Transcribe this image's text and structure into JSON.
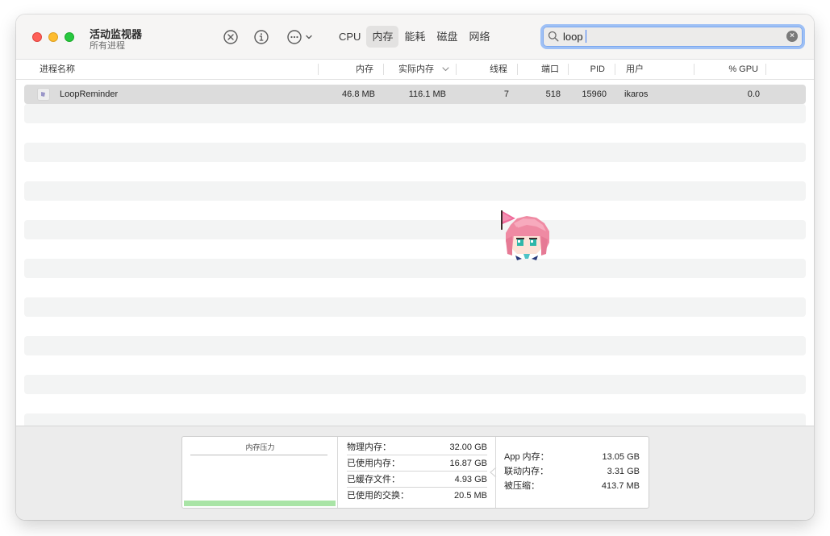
{
  "window": {
    "title": "活动监视器",
    "subtitle": "所有进程"
  },
  "toolbar": {
    "stop_icon": "x-circle-icon",
    "info_icon": "info-icon",
    "more_icon": "ellipsis-circle-icon",
    "tabs": [
      {
        "label": "CPU",
        "active": false
      },
      {
        "label": "内存",
        "active": true
      },
      {
        "label": "能耗",
        "active": false
      },
      {
        "label": "磁盘",
        "active": false
      },
      {
        "label": "网络",
        "active": false
      }
    ]
  },
  "search": {
    "value": "loop",
    "icon": "magnifier-icon"
  },
  "columns": [
    "进程名称",
    "内存",
    "实际内存",
    "线程",
    "端口",
    "PID",
    "用户",
    "% GPU"
  ],
  "processes": [
    {
      "name": "LoopReminder",
      "memory": "46.8 MB",
      "real_memory": "116.1 MB",
      "threads": "7",
      "ports": "518",
      "pid": "15960",
      "user": "ikaros",
      "gpu": "0.0"
    }
  ],
  "footer": {
    "pressure": {
      "title": "内存压力",
      "level": 1.0,
      "color": "#a9e4a6"
    },
    "stats_left": [
      {
        "label": "物理内存：",
        "value": "32.00 GB"
      },
      {
        "label": "已使用内存：",
        "value": "16.87 GB"
      },
      {
        "label": "已缓存文件：",
        "value": "4.93 GB"
      },
      {
        "label": "已使用的交换：",
        "value": "20.5 MB"
      }
    ],
    "stats_right": [
      {
        "label": "App 内存：",
        "value": "13.05 GB"
      },
      {
        "label": "联动内存：",
        "value": "3.31 GB"
      },
      {
        "label": "被压缩：",
        "value": "413.7 MB"
      }
    ]
  }
}
